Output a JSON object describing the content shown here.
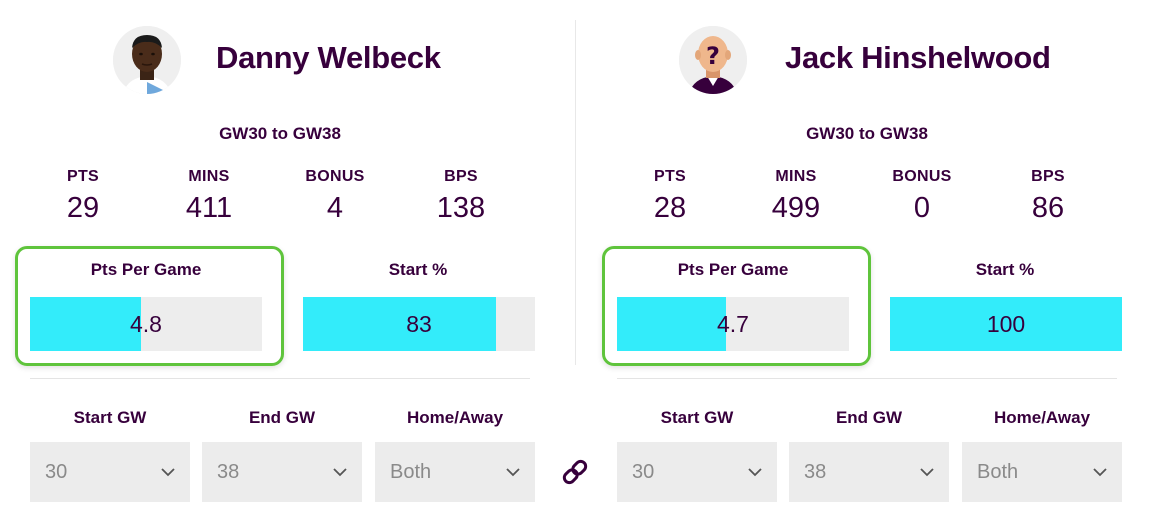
{
  "players": [
    {
      "name": "Danny Welbeck",
      "avatar": "player-photo",
      "range": "GW30 to GW38",
      "stats": [
        {
          "label": "PTS",
          "value": "29"
        },
        {
          "label": "MINS",
          "value": "411"
        },
        {
          "label": "BONUS",
          "value": "4"
        },
        {
          "label": "BPS",
          "value": "138"
        }
      ],
      "metrics": [
        {
          "label": "Pts Per Game",
          "value": "4.8",
          "fill_fraction": 0.48,
          "highlighted": true
        },
        {
          "label": "Start %",
          "value": "83",
          "fill_fraction": 0.83,
          "highlighted": false
        }
      ],
      "filters": [
        {
          "label": "Start GW",
          "value": "30"
        },
        {
          "label": "End GW",
          "value": "38"
        },
        {
          "label": "Home/Away",
          "value": "Both"
        }
      ]
    },
    {
      "name": "Jack Hinshelwood",
      "avatar": "unknown-player-placeholder",
      "range": "GW30 to GW38",
      "stats": [
        {
          "label": "PTS",
          "value": "28"
        },
        {
          "label": "MINS",
          "value": "499"
        },
        {
          "label": "BONUS",
          "value": "0"
        },
        {
          "label": "BPS",
          "value": "86"
        }
      ],
      "metrics": [
        {
          "label": "Pts Per Game",
          "value": "4.7",
          "fill_fraction": 0.47,
          "highlighted": true
        },
        {
          "label": "Start %",
          "value": "100",
          "fill_fraction": 1.0,
          "highlighted": false
        }
      ],
      "filters": [
        {
          "label": "Start GW",
          "value": "30"
        },
        {
          "label": "End GW",
          "value": "38"
        },
        {
          "label": "Home/Away",
          "value": "Both"
        }
      ]
    }
  ],
  "link_icon": "link-icon",
  "colors": {
    "text": "#37003c",
    "bar_fill": "#33ecfa",
    "bar_track": "#ededed",
    "highlight": "#5fc43c",
    "select_bg": "#ececec"
  }
}
